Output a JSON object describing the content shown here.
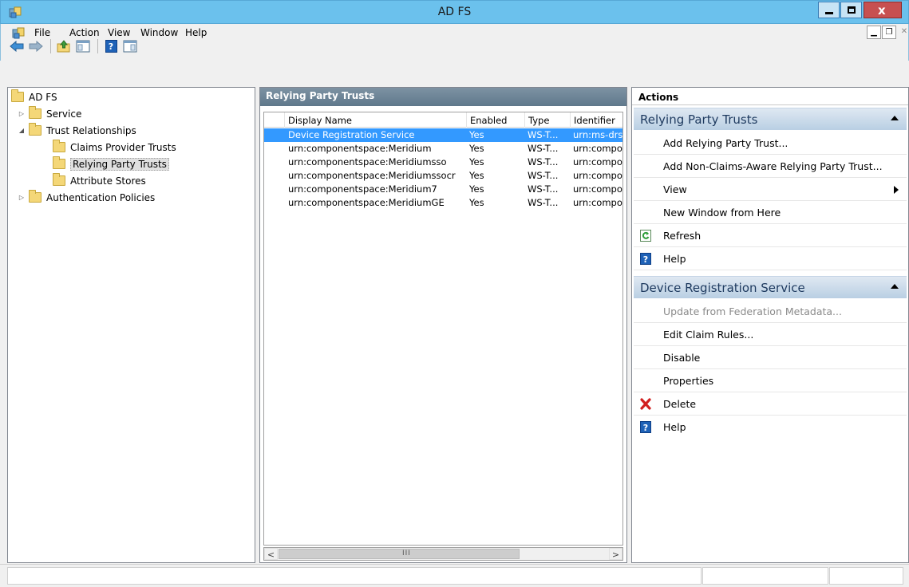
{
  "window": {
    "title": "AD FS",
    "close_glyph": "x"
  },
  "menubar": {
    "items": [
      "File",
      "Action",
      "View",
      "Window",
      "Help"
    ]
  },
  "tree": {
    "items": [
      {
        "label": "AD FS",
        "level": 0,
        "toggle": ""
      },
      {
        "label": "Service",
        "level": 1,
        "toggle": "▷"
      },
      {
        "label": "Trust Relationships",
        "level": 1,
        "toggle": "◢"
      },
      {
        "label": "Claims Provider Trusts",
        "level": 2,
        "toggle": ""
      },
      {
        "label": "Relying Party Trusts",
        "level": 2,
        "toggle": "",
        "selected": true
      },
      {
        "label": "Attribute Stores",
        "level": 2,
        "toggle": ""
      },
      {
        "label": "Authentication Policies",
        "level": 1,
        "toggle": "▷"
      }
    ]
  },
  "list": {
    "header": "Relying Party Trusts",
    "columns": [
      "Display Name",
      "Enabled",
      "Type",
      "Identifier"
    ],
    "rows": [
      {
        "name": "Device Registration Service",
        "enabled": "Yes",
        "type": "WS-T...",
        "identifier": "urn:ms-drs:",
        "selected": true
      },
      {
        "name": "urn:componentspace:Meridium",
        "enabled": "Yes",
        "type": "WS-T...",
        "identifier": "urn:compo"
      },
      {
        "name": "urn:componentspace:Meridiumsso",
        "enabled": "Yes",
        "type": "WS-T...",
        "identifier": "urn:compo"
      },
      {
        "name": "urn:componentspace:Meridiumssocr",
        "enabled": "Yes",
        "type": "WS-T...",
        "identifier": "urn:compo"
      },
      {
        "name": "urn:componentspace:Meridium7",
        "enabled": "Yes",
        "type": "WS-T...",
        "identifier": "urn:compo"
      },
      {
        "name": "urn:componentspace:MeridiumGE",
        "enabled": "Yes",
        "type": "WS-T...",
        "identifier": "urn:compo"
      }
    ],
    "scroll_left": "<",
    "scroll_right": ">",
    "scroll_grip": "III"
  },
  "actions": {
    "header": "Actions",
    "section1": {
      "title": "Relying Party Trusts",
      "items": [
        {
          "label": "Add Relying Party Trust...",
          "icon": ""
        },
        {
          "label": "Add Non-Claims-Aware Relying Party Trust...",
          "icon": ""
        },
        {
          "label": "View",
          "icon": "",
          "submenu": true
        },
        {
          "label": "New Window from Here",
          "icon": ""
        },
        {
          "label": "Refresh",
          "icon": "refresh-icon"
        },
        {
          "label": "Help",
          "icon": "help-icon"
        }
      ]
    },
    "section2": {
      "title": "Device Registration Service",
      "items": [
        {
          "label": "Update from Federation Metadata...",
          "icon": "",
          "disabled": true
        },
        {
          "label": "Edit Claim Rules...",
          "icon": ""
        },
        {
          "label": "Disable",
          "icon": ""
        },
        {
          "label": "Properties",
          "icon": ""
        },
        {
          "label": "Delete",
          "icon": "delete-icon"
        },
        {
          "label": "Help",
          "icon": "help-icon"
        }
      ]
    },
    "help_glyph": "?"
  },
  "colors": {
    "titlebar": "#6bc1ed",
    "selection": "#3399ff",
    "section_header": "#b9cfe3",
    "delete": "#d11f1f",
    "refresh": "#2f9e3a"
  }
}
